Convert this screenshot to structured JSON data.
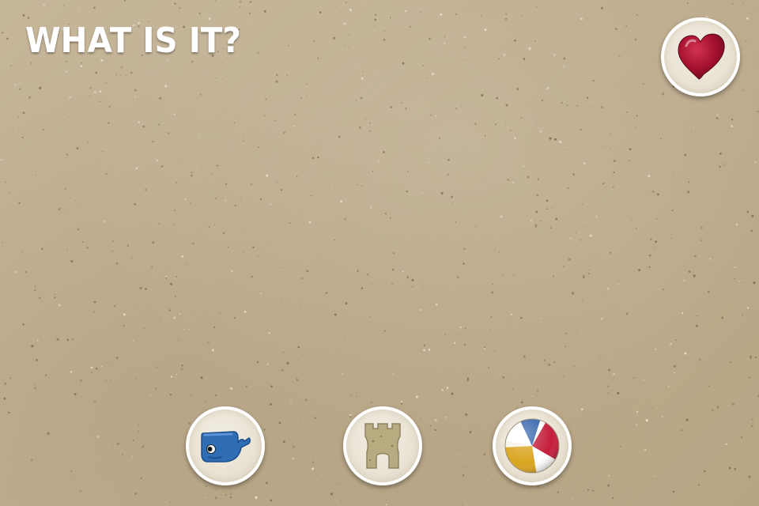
{
  "header": {
    "title": "WHAT IS IT?"
  },
  "favorite_button": {
    "icon": "heart-icon",
    "color": "#a3102e"
  },
  "choices": [
    {
      "icon": "whale-icon",
      "color": "#2f6db5"
    },
    {
      "icon": "sandcastle-icon",
      "color": "#b9ab80"
    },
    {
      "icon": "beach-ball-icon",
      "colors": [
        "#d9a520",
        "#c41e3a",
        "#2f5fa8",
        "#ffffff"
      ]
    }
  ],
  "colors": {
    "background": "#c2b193",
    "button_border": "#ffffff",
    "title": "#ffffff"
  }
}
